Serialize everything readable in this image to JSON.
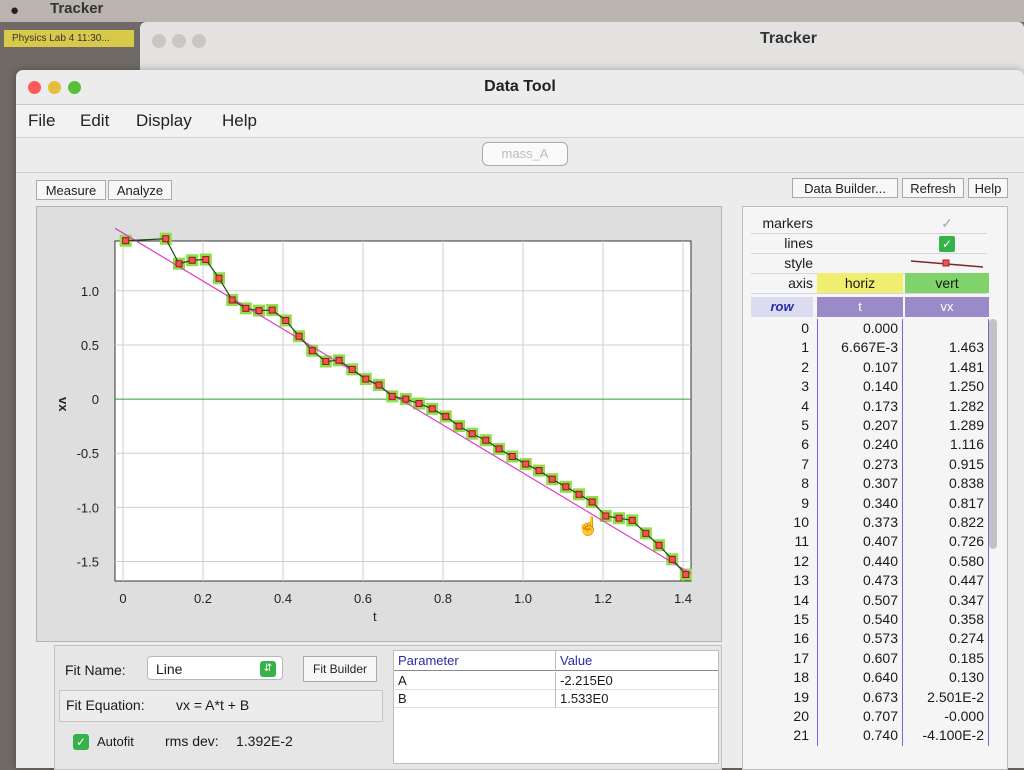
{
  "menubar": {
    "app_name": "Tracker"
  },
  "doc_tab": {
    "label": "Physics Lab 4 11:30..."
  },
  "bg_window": {
    "title": "Tracker"
  },
  "window": {
    "title": "Data Tool",
    "menu": [
      "File",
      "Edit",
      "Display",
      "Help"
    ],
    "dataset_tab": "mass_A"
  },
  "toolbar": {
    "measure": "Measure",
    "analyze": "Analyze",
    "data_builder": "Data Builder...",
    "refresh": "Refresh",
    "help": "Help"
  },
  "chart_data": {
    "type": "scatter",
    "xlabel": "t",
    "ylabel": "vx",
    "xlim": [
      -0.02,
      1.42
    ],
    "ylim": [
      -1.68,
      1.46
    ],
    "x_ticks": [
      "0",
      "0.2",
      "0.4",
      "0.6",
      "0.8",
      "1.0",
      "1.2",
      "1.4"
    ],
    "y_ticks": [
      "1.0",
      "0.5",
      "0",
      "-0.5",
      "-1.0",
      "-1.5"
    ],
    "grid": true,
    "series": [
      {
        "x": [
          0.0067,
          0.107,
          0.14,
          0.173,
          0.207,
          0.24,
          0.273,
          0.307,
          0.34,
          0.373,
          0.407,
          0.44,
          0.473,
          0.507,
          0.54,
          0.573,
          0.607,
          0.64,
          0.673,
          0.707,
          0.74,
          0.773,
          0.807,
          0.84,
          0.873,
          0.907,
          0.94,
          0.973,
          1.007,
          1.04,
          1.073,
          1.107,
          1.14,
          1.173,
          1.207,
          1.24,
          1.273,
          1.307,
          1.34,
          1.373,
          1.407
        ],
        "values": [
          1.463,
          1.481,
          1.25,
          1.282,
          1.289,
          1.116,
          0.915,
          0.838,
          0.817,
          0.822,
          0.726,
          0.58,
          0.447,
          0.347,
          0.358,
          0.274,
          0.185,
          0.13,
          0.02501,
          -0.0,
          -0.041,
          -0.09,
          -0.16,
          -0.25,
          -0.32,
          -0.38,
          -0.46,
          -0.53,
          -0.6,
          -0.66,
          -0.74,
          -0.81,
          -0.88,
          -0.95,
          -1.08,
          -1.1,
          -1.12,
          -1.24,
          -1.35,
          -1.48,
          -1.62
        ]
      }
    ],
    "fit_line": {
      "A": -2.215,
      "B": 1.533
    }
  },
  "fit": {
    "name_label": "Fit Name:",
    "name": "Line",
    "builder": "Fit Builder",
    "equation_label": "Fit Equation:",
    "equation": "vx = A*t + B",
    "autofit": "Autofit",
    "rms_label": "rms dev:",
    "rms": "1.392E-2",
    "param_header": "Parameter",
    "value_header": "Value",
    "params": [
      {
        "name": "A",
        "value": "-2.215E0"
      },
      {
        "name": "B",
        "value": "1.533E0"
      }
    ]
  },
  "table": {
    "props": {
      "markers": "markers",
      "lines": "lines",
      "style": "style",
      "axis": "axis"
    },
    "axis_horiz": "horiz",
    "axis_vert": "vert",
    "columns": {
      "row": "row",
      "t": "t",
      "vx": "vx"
    },
    "rows": [
      {
        "row": "0",
        "t": "0.000",
        "vx": ""
      },
      {
        "row": "1",
        "t": "6.667E-3",
        "vx": "1.463"
      },
      {
        "row": "2",
        "t": "0.107",
        "vx": "1.481"
      },
      {
        "row": "3",
        "t": "0.140",
        "vx": "1.250"
      },
      {
        "row": "4",
        "t": "0.173",
        "vx": "1.282"
      },
      {
        "row": "5",
        "t": "0.207",
        "vx": "1.289"
      },
      {
        "row": "6",
        "t": "0.240",
        "vx": "1.116"
      },
      {
        "row": "7",
        "t": "0.273",
        "vx": "0.915"
      },
      {
        "row": "8",
        "t": "0.307",
        "vx": "0.838"
      },
      {
        "row": "9",
        "t": "0.340",
        "vx": "0.817"
      },
      {
        "row": "10",
        "t": "0.373",
        "vx": "0.822"
      },
      {
        "row": "11",
        "t": "0.407",
        "vx": "0.726"
      },
      {
        "row": "12",
        "t": "0.440",
        "vx": "0.580"
      },
      {
        "row": "13",
        "t": "0.473",
        "vx": "0.447"
      },
      {
        "row": "14",
        "t": "0.507",
        "vx": "0.347"
      },
      {
        "row": "15",
        "t": "0.540",
        "vx": "0.358"
      },
      {
        "row": "16",
        "t": "0.573",
        "vx": "0.274"
      },
      {
        "row": "17",
        "t": "0.607",
        "vx": "0.185"
      },
      {
        "row": "18",
        "t": "0.640",
        "vx": "0.130"
      },
      {
        "row": "19",
        "t": "0.673",
        "vx": "2.501E-2"
      },
      {
        "row": "20",
        "t": "0.707",
        "vx": "-0.000"
      },
      {
        "row": "21",
        "t": "0.740",
        "vx": "-4.100E-2"
      }
    ]
  },
  "colors": {
    "point_fill": "#e8565a",
    "point_halo": "#8be04a",
    "connect_line": "#1a4a1a",
    "fit_line": "#e03cc8",
    "zero_line": "#2ea12e",
    "axis_yellow": "#f0ee6e",
    "axis_green": "#7fd36a"
  }
}
